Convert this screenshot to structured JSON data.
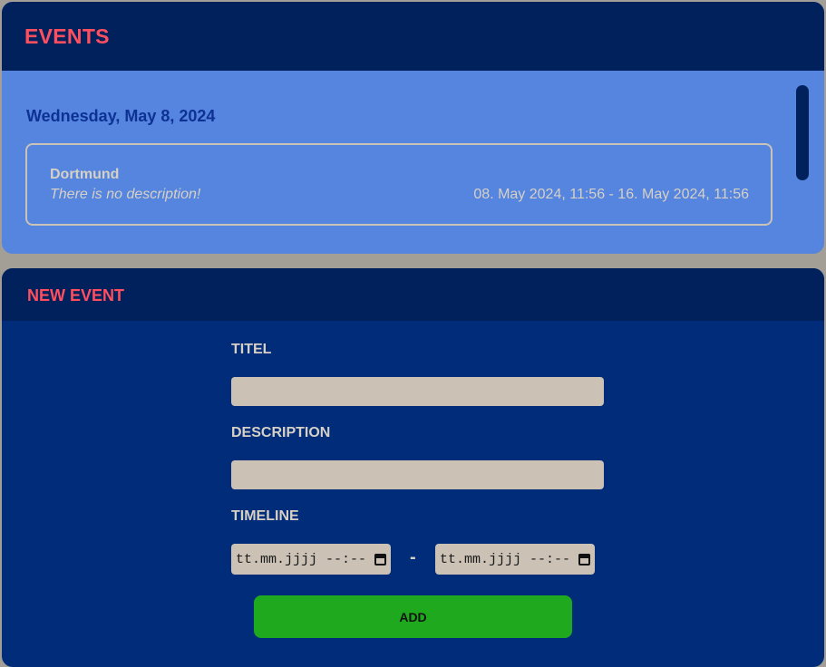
{
  "events_panel": {
    "title": "EVENTS",
    "day_heading": "Wednesday, May 8, 2024",
    "events": [
      {
        "name": "Dortmund",
        "description": "There is no description!",
        "range": "08. May 2024, 11:56 - 16. May 2024, 11:56"
      }
    ]
  },
  "new_event_panel": {
    "title": "NEW EVENT",
    "title_label": "TITEL",
    "title_value": "",
    "description_label": "DESCRIPTION",
    "description_value": "",
    "timeline_label": "TIMELINE",
    "start_placeholder": "tt.mm.jjjj --:--",
    "end_placeholder": "tt.mm.jjjj --:--",
    "range_separator": "-",
    "add_label": "ADD"
  },
  "colors": {
    "header_bg": "#00215c",
    "events_bg": "#5585de",
    "form_bg": "#002c79",
    "accent_title": "#ff4f5f",
    "add_button": "#1fa91f",
    "input_bg": "#cbc2b5"
  },
  "icons": {
    "date_picker": "calendar-icon"
  }
}
